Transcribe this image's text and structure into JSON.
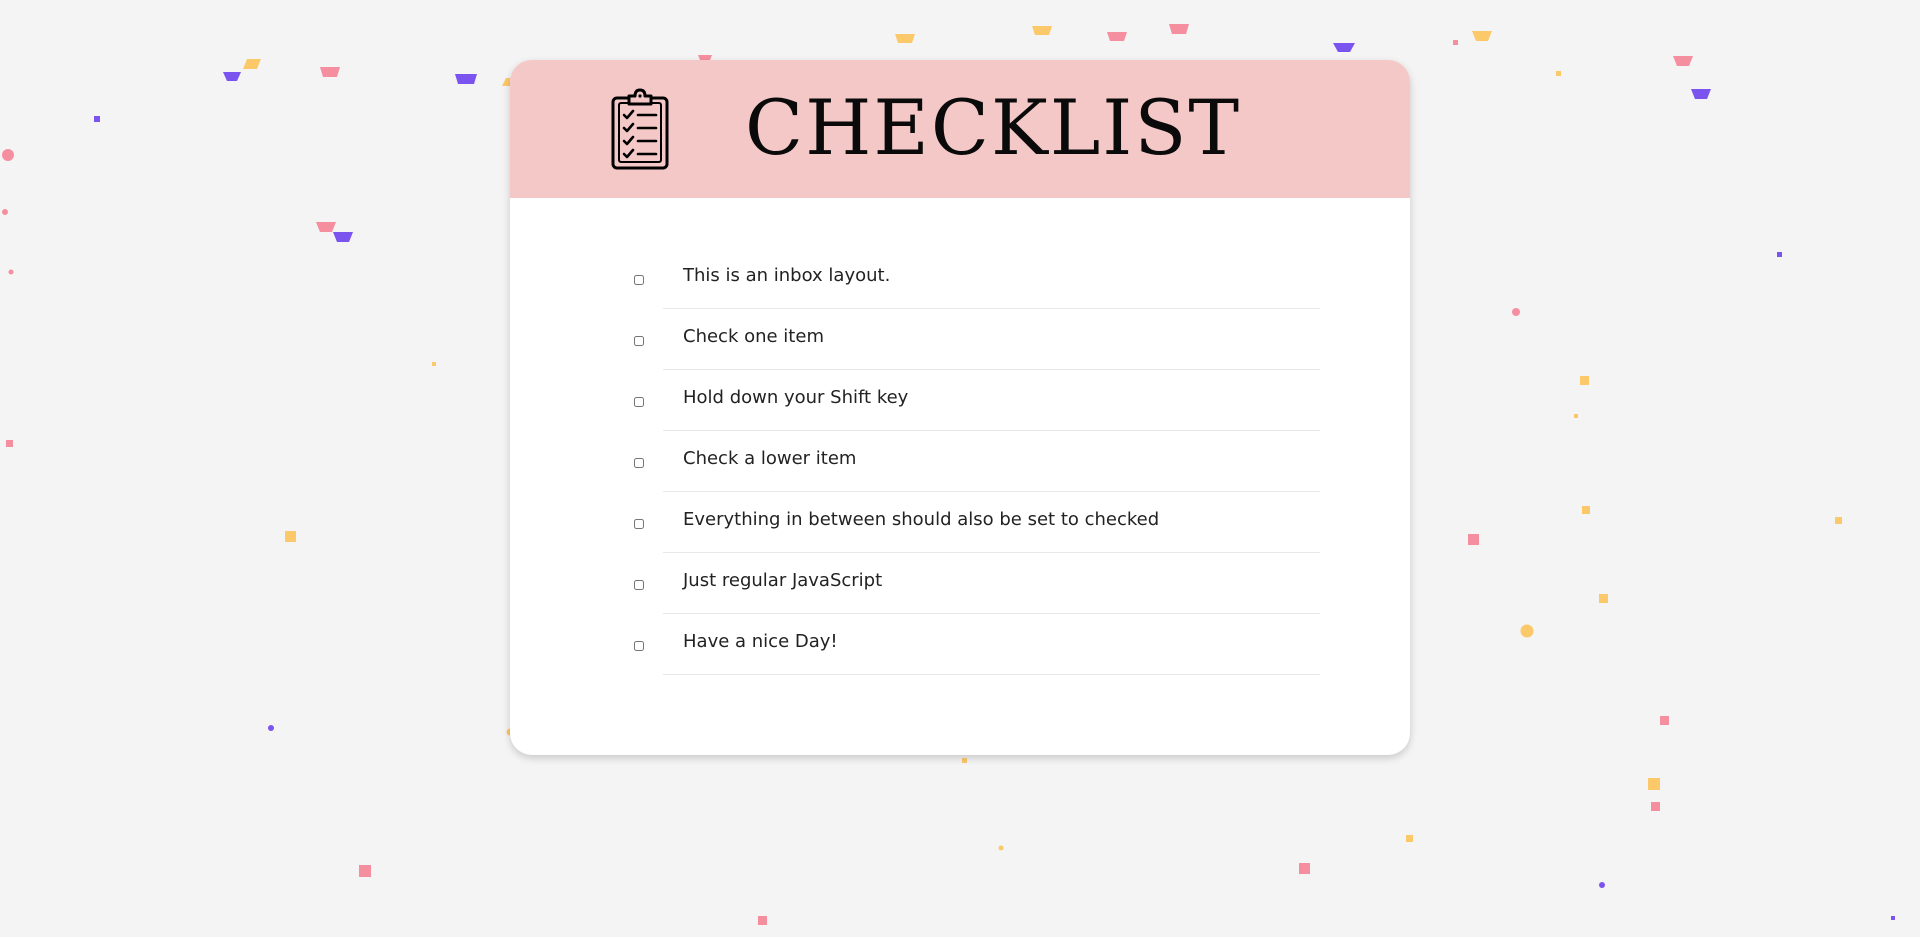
{
  "colors": {
    "background": "#f4f4f4",
    "card": "#ffffff",
    "header": "#f5c8c8",
    "text": "#222222",
    "confetti": [
      "#f58fa0",
      "#7b53ef",
      "#fcc96a"
    ]
  },
  "header": {
    "title": "CHECKLIST",
    "icon": "clipboard-checklist-icon"
  },
  "checklist": {
    "items": [
      {
        "label": "This is an inbox layout.",
        "checked": false
      },
      {
        "label": "Check one item",
        "checked": false
      },
      {
        "label": "Hold down your Shift key",
        "checked": false
      },
      {
        "label": "Check a lower item",
        "checked": false
      },
      {
        "label": "Everything in between should also be set to checked",
        "checked": false
      },
      {
        "label": "Just regular JavaScript",
        "checked": false
      },
      {
        "label": "Have a nice Day!",
        "checked": false
      }
    ]
  }
}
